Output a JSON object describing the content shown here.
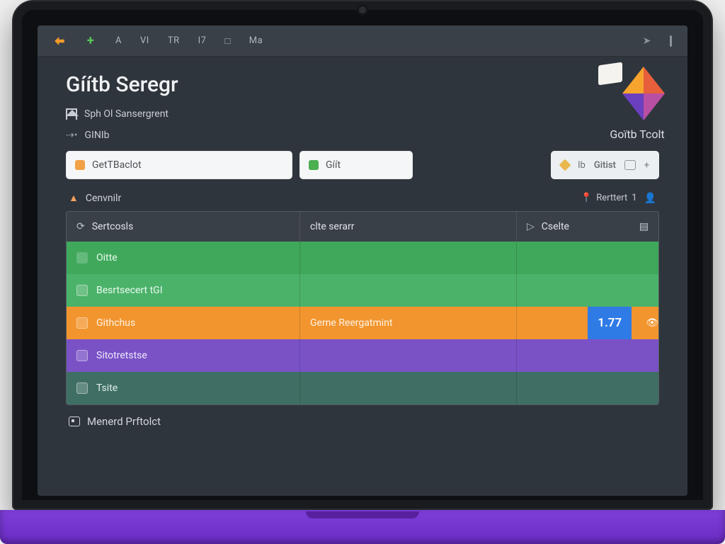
{
  "topbar": {
    "tabs": [
      "A",
      "VI",
      "TR",
      "I7",
      "□",
      "Ma"
    ]
  },
  "brand": {
    "name": "Goïtb Tcolt"
  },
  "page": {
    "title": "Gíítb Seregr",
    "breadcrumb": "Sph Ol Sansergrent",
    "subnav": "GINIb"
  },
  "search": {
    "left_placeholder": "GetTBaclot",
    "mid_placeholder": "Gíít",
    "right_left_glyph": "Ib",
    "right_label": "Gitist"
  },
  "catrow": {
    "left": "Cenvnilr",
    "stat_label": "Rerttert",
    "stat_value": "1"
  },
  "thead": {
    "c1": "Sertcosls",
    "c2": "clte serarr",
    "c3": "Cselte"
  },
  "rows": [
    {
      "color": "r-green",
      "c1": "Oitte",
      "c2": "",
      "c3": ""
    },
    {
      "color": "r-green2",
      "c1": "Besrtsecert tGI",
      "c2": "",
      "c3": ""
    },
    {
      "color": "r-orange",
      "c1": "Githchus",
      "c2": "Gerne Reergatmint",
      "c3": "1.77",
      "badge": true
    },
    {
      "color": "r-purple",
      "c1": "Sitotretstse",
      "c2": "",
      "c3": ""
    },
    {
      "color": "r-teal",
      "c1": "Tsite",
      "c2": "",
      "c3": ""
    }
  ],
  "footer": {
    "label": "Menerd Prftolct"
  },
  "colors": {
    "bg": "#2f353c",
    "panel": "#3a4047",
    "green": "#3fa85a",
    "orange": "#f2952e",
    "purple": "#7a52c6",
    "blue": "#2f7be6"
  }
}
